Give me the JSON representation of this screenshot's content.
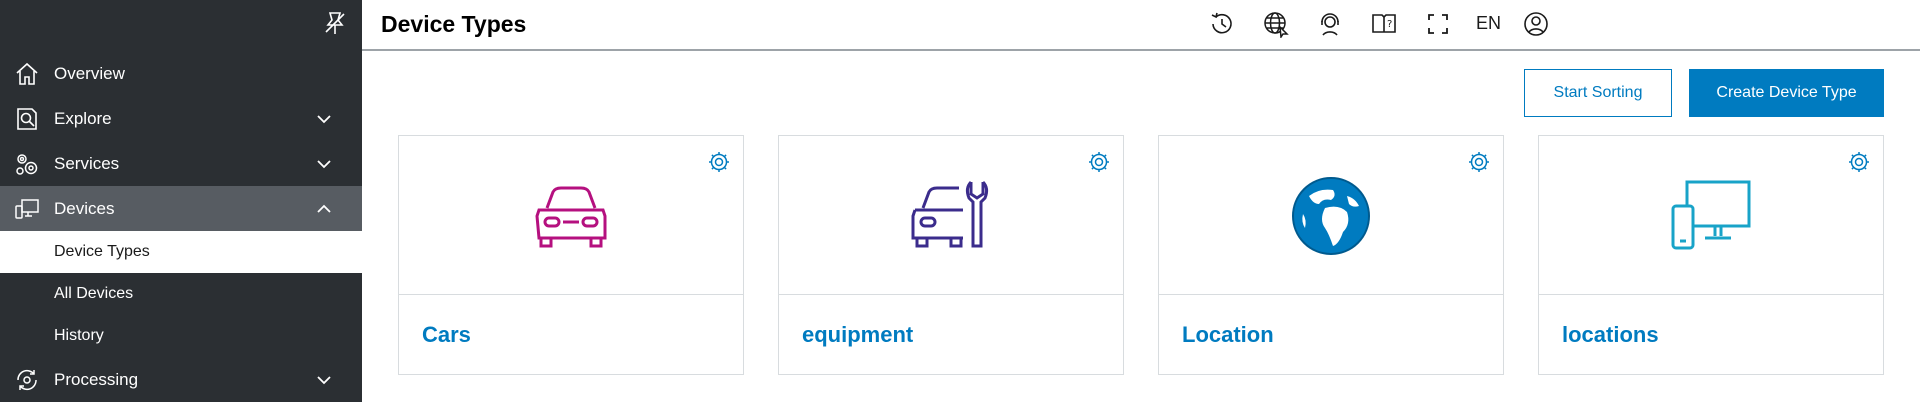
{
  "header": {
    "title": "Device Types",
    "language": "EN",
    "icons": [
      "history-icon",
      "globe-icon",
      "support-icon",
      "help-book-icon",
      "fullscreen-icon",
      "user-icon"
    ]
  },
  "sidebar": {
    "pin_icon": "unpin-icon",
    "items": [
      {
        "label": "Overview",
        "icon": "home-icon"
      },
      {
        "label": "Explore",
        "icon": "explore-icon",
        "chevron": "chevron-down-icon"
      },
      {
        "label": "Services",
        "icon": "services-icon",
        "chevron": "chevron-down-icon"
      },
      {
        "label": "Devices",
        "icon": "devices-icon",
        "chevron": "chevron-up-icon"
      },
      {
        "label": "Processing",
        "icon": "processing-icon",
        "chevron": "chevron-down-icon"
      }
    ],
    "sub_items": [
      {
        "label": "Device Types"
      },
      {
        "label": "All Devices"
      },
      {
        "label": "History"
      }
    ]
  },
  "actions": {
    "sort_label": "Start Sorting",
    "create_label": "Create Device Type"
  },
  "cards": [
    {
      "name": "Cars",
      "icon": "car-icon",
      "color": "#b5107f"
    },
    {
      "name": "equipment",
      "icon": "car-wrench-icon",
      "color": "#3b2c8c"
    },
    {
      "name": "Location",
      "icon": "globe-earth-icon",
      "color": "#007bc0"
    },
    {
      "name": "locations",
      "icon": "devices-monitor-phone-icon",
      "color": "#18a3c8"
    }
  ],
  "colors": {
    "sidebar_bg": "#2b2f33",
    "active_bg": "#575c62",
    "accent": "#007bc0"
  }
}
